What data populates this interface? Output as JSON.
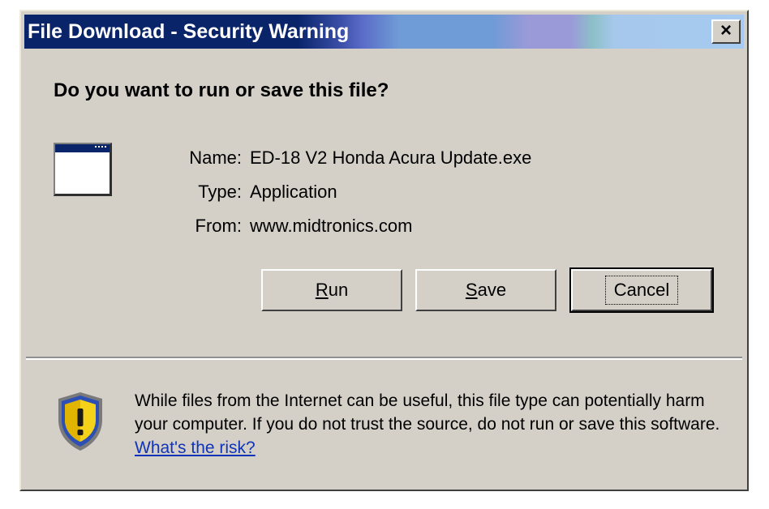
{
  "window": {
    "title": "File Download - Security Warning",
    "close_label": "×"
  },
  "question": "Do you want to run or save this file?",
  "file": {
    "name_label": "Name:",
    "name_value": "ED-18 V2 Honda Acura Update.exe",
    "type_label": "Type:",
    "type_value": "Application",
    "from_label": "From:",
    "from_value": "www.midtronics.com"
  },
  "buttons": {
    "run_mnemonic": "R",
    "run_rest": "un",
    "save_mnemonic": "S",
    "save_rest": "ave",
    "cancel": "Cancel"
  },
  "warning": {
    "text": "While files from the Internet can be useful, this file type can potentially harm your computer. If you do not trust the source, do not run or save this software.",
    "link": "What's the risk?"
  },
  "icons": {
    "file": "application-window-icon",
    "warning": "security-shield-icon",
    "close": "close-icon"
  },
  "colors": {
    "titlebar_start": "#0a246a",
    "titlebar_end": "#a6caf0",
    "dialog_bg": "#d4d0c8",
    "link": "#1034b8",
    "shield_yellow": "#f4d21a"
  }
}
